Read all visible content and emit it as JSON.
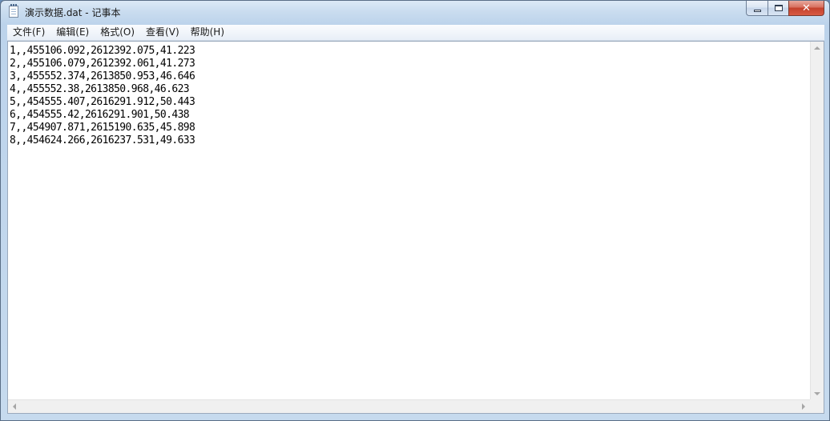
{
  "window": {
    "title": "演示数据.dat - 记事本",
    "icon": "notepad-icon",
    "controls": {
      "minimize_icon": "minimize-icon",
      "maximize_icon": "maximize-icon",
      "close_icon": "close-icon",
      "close_glyph": "✕"
    }
  },
  "menubar": {
    "items": [
      {
        "label": "文件(F)"
      },
      {
        "label": "编辑(E)"
      },
      {
        "label": "格式(O)"
      },
      {
        "label": "查看(V)"
      },
      {
        "label": "帮助(H)"
      }
    ]
  },
  "editor": {
    "lines": [
      "1,,455106.092,2612392.075,41.223",
      "2,,455106.079,2612392.061,41.273",
      "3,,455552.374,2613850.953,46.646",
      "4,,455552.38,2613850.968,46.623",
      "5,,454555.407,2616291.912,50.443",
      "6,,454555.42,2616291.901,50.438",
      "7,,454907.871,2615190.635,45.898",
      "8,,454624.266,2616237.531,49.633"
    ]
  },
  "colors": {
    "close_button": "#c4412c",
    "titlebar": "#c9dcef",
    "editor_background": "#ffffff"
  }
}
